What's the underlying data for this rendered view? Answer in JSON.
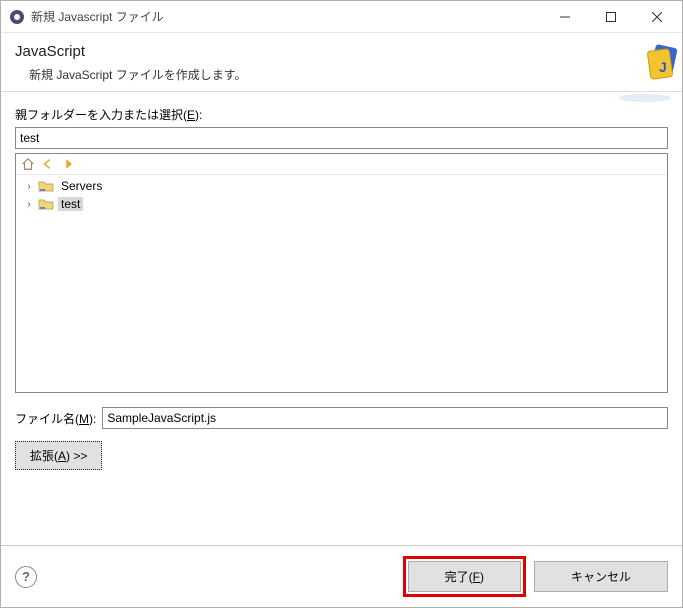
{
  "window": {
    "title": "新規 Javascript ファイル"
  },
  "header": {
    "title": "JavaScript",
    "subtitle": "新規 JavaScript ファイルを作成します。"
  },
  "body": {
    "parentFolderLabelPrefix": "親フォルダーを入力または選択(",
    "parentFolderMnemonic": "E",
    "parentFolderLabelSuffix": "):",
    "parentFolderValue": "test",
    "treeItems": [
      {
        "name": "Servers",
        "selected": false
      },
      {
        "name": "test",
        "selected": true
      }
    ],
    "fileNameLabelPrefix": "ファイル名(",
    "fileNameMnemonic": "M",
    "fileNameLabelSuffix": "):",
    "fileNameValue": "SampleJavaScript.js",
    "advancedPrefix": "拡張(",
    "advancedMnemonic": "A",
    "advancedSuffix": ") >>"
  },
  "footer": {
    "finishPrefix": "完了(",
    "finishMnemonic": "F",
    "finishSuffix": ")",
    "cancel": "キャンセル"
  }
}
